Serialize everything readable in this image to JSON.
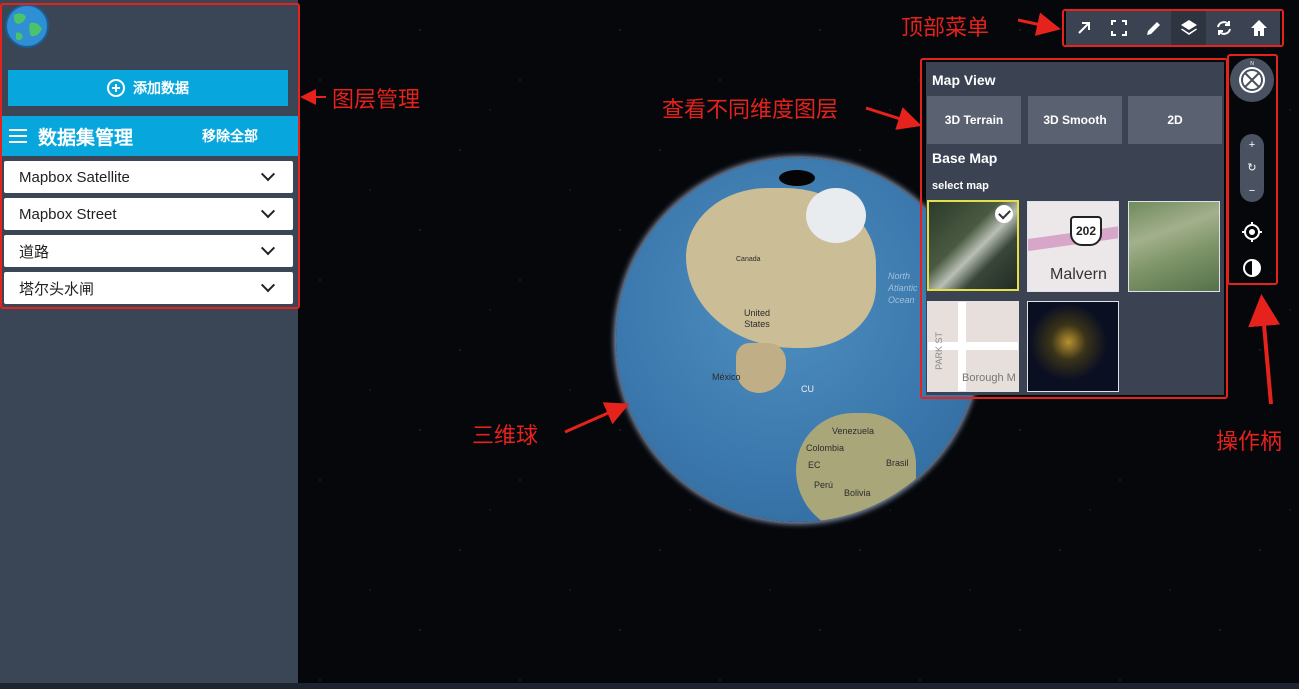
{
  "sidebar": {
    "add_data_label": "添加数据",
    "dataset_title": "数据集管理",
    "remove_all_label": "移除全部",
    "layers": [
      {
        "label": "Mapbox Satellite"
      },
      {
        "label": "Mapbox Street"
      },
      {
        "label": "道路"
      },
      {
        "label": "塔尔头水闸"
      }
    ]
  },
  "globe": {
    "labels": [
      "Canada",
      "United States",
      "México",
      "CU",
      "Venezuela",
      "Colombia",
      "EC",
      "Perú",
      "Brasil",
      "Bolivia",
      "North Atlantic Ocean"
    ]
  },
  "map_panel": {
    "map_view_title": "Map View",
    "view_modes": [
      {
        "label": "3D Terrain"
      },
      {
        "label": "3D Smooth"
      },
      {
        "label": "2D"
      }
    ],
    "base_map_title": "Base Map",
    "select_map_label": "select map",
    "thumbnails": [
      {
        "name": "satellite",
        "selected": true
      },
      {
        "name": "streets",
        "selected": false,
        "road_number": "202",
        "place_label": "Malvern"
      },
      {
        "name": "aerial",
        "selected": false
      },
      {
        "name": "light",
        "selected": false,
        "street_label": "PARK ST",
        "place_label": "Borough M"
      },
      {
        "name": "night",
        "selected": false
      }
    ]
  },
  "toolbar": {
    "icons": [
      "arrow-up-right-icon",
      "fullscreen-icon",
      "pencil-icon",
      "layers-icon",
      "refresh-icon",
      "home-icon"
    ],
    "active": "layers-icon"
  },
  "navigation": {
    "zoom_in": "+",
    "reset": "↻",
    "zoom_out": "−"
  },
  "annotations": {
    "layer_management": "图层管理",
    "top_menu": "顶部菜单",
    "dimension_layers": "查看不同维度图层",
    "globe_3d": "三维球",
    "control_handle": "操作柄"
  },
  "colors": {
    "accent": "#07a6dc",
    "sidebar_bg": "#3a4556",
    "panel_bg": "#3b4252",
    "annotation_red": "#e5221b",
    "selected_border": "#e3e04a"
  }
}
